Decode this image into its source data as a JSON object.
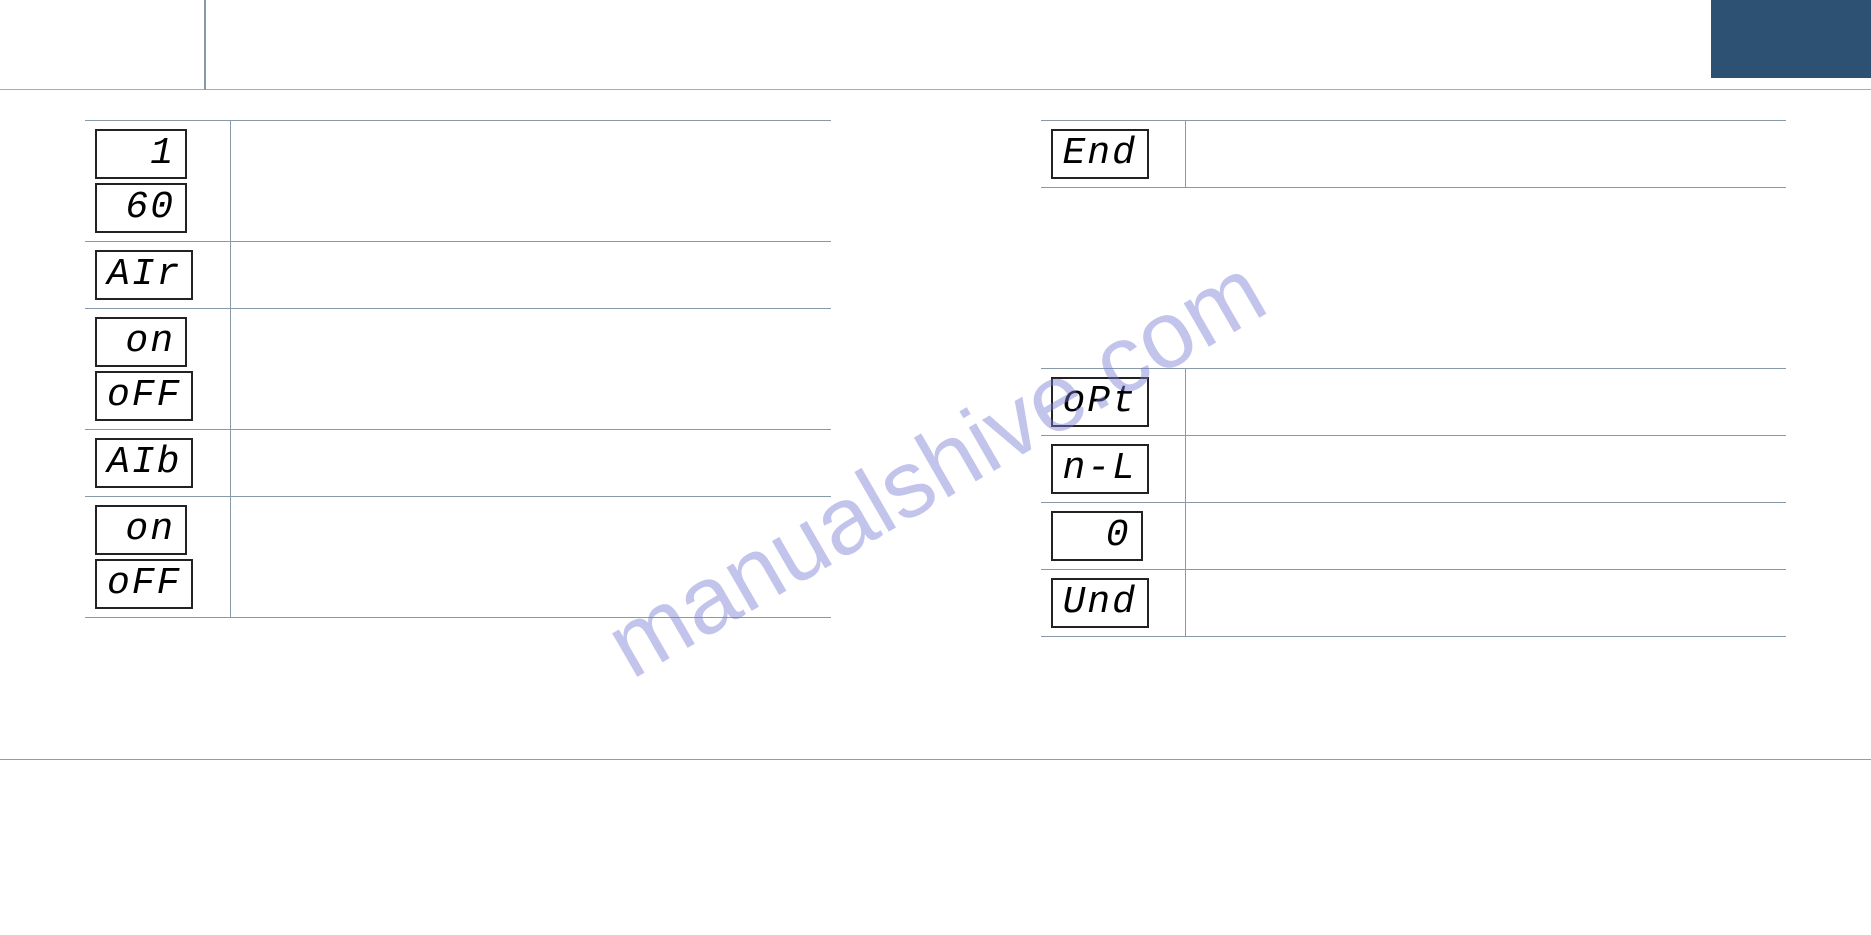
{
  "watermark": "manualshive.com",
  "left_rows": [
    {
      "icons": [
        "1",
        "60"
      ],
      "title": "",
      "desc": ""
    },
    {
      "icons": [
        "AIr"
      ],
      "title": "",
      "desc": ""
    },
    {
      "icons": [
        "on",
        "oFF"
      ],
      "title": "",
      "desc": ""
    },
    {
      "icons": [
        "AIb"
      ],
      "title": "",
      "desc": ""
    },
    {
      "icons": [
        "on",
        "oFF"
      ],
      "title": "",
      "desc": ""
    }
  ],
  "right_rows_1": [
    {
      "icons": [
        "End"
      ],
      "title": "",
      "desc": ""
    }
  ],
  "right_rows_2": [
    {
      "icons": [
        "oPt"
      ],
      "title": "",
      "desc": ""
    },
    {
      "icons": [
        "n-L"
      ],
      "title": "",
      "desc": ""
    },
    {
      "icons": [
        "0"
      ],
      "title": "",
      "desc": ""
    },
    {
      "icons": [
        "Und"
      ],
      "title": "",
      "desc": ""
    }
  ]
}
